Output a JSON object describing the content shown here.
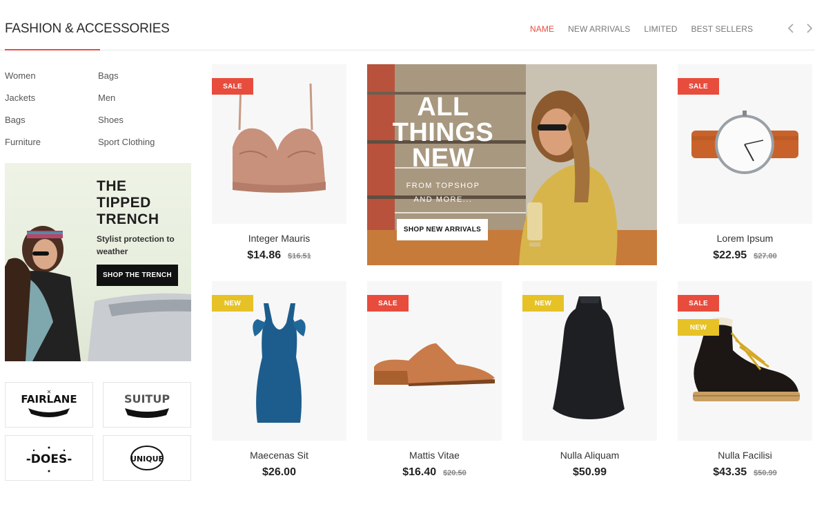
{
  "header": {
    "title": "FASHION & ACCESSORIES",
    "tabs": [
      {
        "label": "NAME",
        "active": true
      },
      {
        "label": "NEW ARRIVALS",
        "active": false
      },
      {
        "label": "LIMITED",
        "active": false
      },
      {
        "label": "BEST SELLERS",
        "active": false
      }
    ],
    "accent_color": "#e84c3d"
  },
  "categories": [
    "Women",
    "Bags",
    "Jackets",
    "Men",
    "Bags",
    "Shoes",
    "Furniture",
    "Sport Clothing"
  ],
  "trench_banner": {
    "title": "THE TIPPED TRENCH",
    "subtitle": "Stylist protection to weather",
    "button": "SHOP THE TRENCH"
  },
  "brands": [
    "FAIRLANE",
    "SUITUP",
    "-DOES-",
    "UNIQUE"
  ],
  "hero": {
    "title": "ALL THINGS NEW",
    "subtitle": "FROM TOPSHOP AND MORE...",
    "button": "SHOP NEW ARRIVALS"
  },
  "products": [
    {
      "name": "Integer Mauris",
      "price": "$14.86",
      "old_price": "$16.51",
      "badges": [
        "SALE"
      ],
      "icon": "bralette-icon"
    },
    {
      "name": "Lorem Ipsum",
      "price": "$22.95",
      "old_price": "$27.00",
      "badges": [
        "SALE"
      ],
      "icon": "watch-icon"
    },
    {
      "name": "Maecenas Sit",
      "price": "$26.00",
      "old_price": "",
      "badges": [
        "NEW"
      ],
      "icon": "dress-icon"
    },
    {
      "name": "Mattis Vitae",
      "price": "$16.40",
      "old_price": "$20.50",
      "badges": [
        "SALE"
      ],
      "icon": "mule-shoe-icon"
    },
    {
      "name": "Nulla Aliquam",
      "price": "$50.99",
      "old_price": "",
      "badges": [
        "NEW"
      ],
      "icon": "black-top-icon"
    },
    {
      "name": "Nulla Facilisi",
      "price": "$43.35",
      "old_price": "$50.99",
      "badges": [
        "SALE",
        "NEW"
      ],
      "icon": "boot-icon"
    }
  ],
  "colors": {
    "sale": "#e84c3d",
    "new": "#e6c227",
    "button_dark": "#111111"
  }
}
